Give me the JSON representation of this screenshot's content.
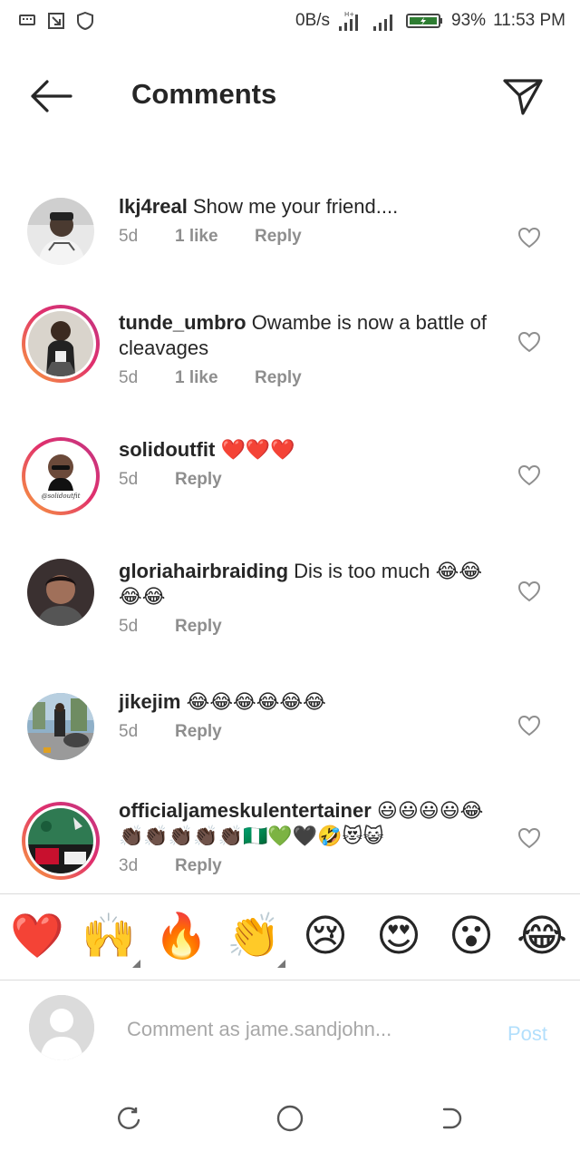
{
  "status_bar": {
    "net_speed": "0B/s",
    "network_type": "H+",
    "battery": "93%",
    "time": "11:53 PM"
  },
  "header": {
    "title": "Comments"
  },
  "comments": [
    {
      "username": "lkj4real",
      "text": "Show me your friend....",
      "time": "5d",
      "likes": "1 like",
      "reply": "Reply",
      "story_ring": false
    },
    {
      "username": "tunde_umbro",
      "text": "Owambe is now a battle of cleavages",
      "time": "5d",
      "likes": "1 like",
      "reply": "Reply",
      "story_ring": true
    },
    {
      "username": "solidoutfit",
      "text": "❤️❤️❤️",
      "time": "5d",
      "likes": "",
      "reply": "Reply",
      "story_ring": true,
      "avatar_caption": "@solidoutfit"
    },
    {
      "username": "gloriahairbraiding",
      "text": "Dis is too much 😂😂😂😂",
      "time": "5d",
      "likes": "",
      "reply": "Reply",
      "story_ring": false
    },
    {
      "username": "jikejim",
      "text": "😂😂😂😂😂😂",
      "time": "5d",
      "likes": "",
      "reply": "Reply",
      "story_ring": false
    },
    {
      "username": "officialjameskulentertainer",
      "text": "😃😃😃😃😂👏🏿👏🏿👏🏿👏🏿👏🏿🇳🇬💚🖤🤣😻😺",
      "time": "3d",
      "likes": "",
      "reply": "Reply",
      "story_ring": true
    }
  ],
  "quick_reactions": [
    "❤️",
    "🙌",
    "🔥",
    "👏",
    "😢",
    "😍",
    "😮",
    "😂"
  ],
  "composer": {
    "placeholder": "Comment as jame.sandjohn...",
    "post_label": "Post"
  },
  "colors": {
    "text": "#262626",
    "muted": "#8e8e8e",
    "post_disabled": "#b2dffc",
    "heart_red": "#ed4956"
  },
  "icons": {
    "back": "arrow-left-icon",
    "send": "paper-plane-icon",
    "like": "heart-outline-icon",
    "nav": [
      "recent-apps-icon",
      "home-icon",
      "back-nav-icon"
    ]
  }
}
